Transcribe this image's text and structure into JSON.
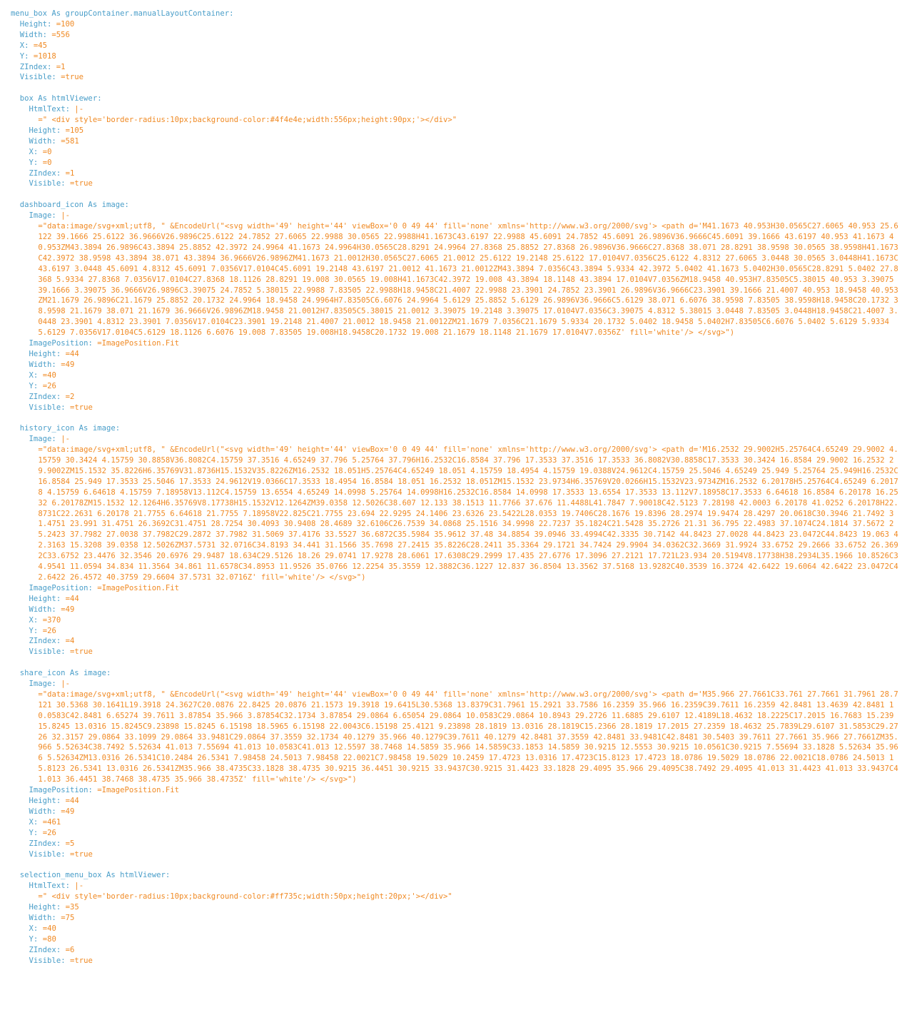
{
  "colors": {
    "key": "#4a9ec9",
    "value": "#f08a24",
    "background": "#ffffff"
  },
  "lines": [
    {
      "i": 0,
      "k": "menu_box As groupContainer.manualLayoutContainer:",
      "v": ""
    },
    {
      "i": 2,
      "k": "Height: ",
      "v": "=100"
    },
    {
      "i": 2,
      "k": "Width: ",
      "v": "=556"
    },
    {
      "i": 2,
      "k": "X: ",
      "v": "=45"
    },
    {
      "i": 2,
      "k": "Y: ",
      "v": "=1018"
    },
    {
      "i": 2,
      "k": "ZIndex: ",
      "v": "=1"
    },
    {
      "i": 2,
      "k": "Visible: ",
      "v": "=true"
    },
    {
      "i": 0,
      "k": "",
      "v": ""
    },
    {
      "i": 2,
      "k": "box As htmlViewer:",
      "v": ""
    },
    {
      "i": 4,
      "k": "HtmlText: ",
      "v": "|-"
    },
    {
      "i": 6,
      "k": "",
      "v": "=\" <div style='border-radius:10px;background-color:#4f4e4e;width:556px;height:90px;'></div>\""
    },
    {
      "i": 4,
      "k": "Height: ",
      "v": "=105"
    },
    {
      "i": 4,
      "k": "Width: ",
      "v": "=581"
    },
    {
      "i": 4,
      "k": "X: ",
      "v": "=0"
    },
    {
      "i": 4,
      "k": "Y: ",
      "v": "=0"
    },
    {
      "i": 4,
      "k": "ZIndex: ",
      "v": "=1"
    },
    {
      "i": 4,
      "k": "Visible: ",
      "v": "=true"
    },
    {
      "i": 0,
      "k": "",
      "v": ""
    },
    {
      "i": 2,
      "k": "dashboard_icon As image:",
      "v": ""
    },
    {
      "i": 4,
      "k": "Image: ",
      "v": "|-"
    },
    {
      "i": 6,
      "k": "",
      "v": "=\"data:image/svg+xml;utf8, \" &EncodeUrl(\"<svg width='49' height='44' viewBox='0 0 49 44' fill='none' xmlns='http://www.w3.org/2000/svg'> <path d='M41.1673 40.953H30.0565C27.6065 40.953 25.6122 39.1666 25.6122 36.9666V26.9896C25.6122 24.7852 27.6065 22.9988 30.0565 22.9988H41.1673C43.6197 22.9988 45.6091 24.7852 45.6091 26.9896V36.9666C45.6091 39.1666 43.6197 40.953 41.1673 40.953ZM43.3894 26.9896C43.3894 25.8852 42.3972 24.9964 41.1673 24.9964H30.0565C28.8291 24.9964 27.8368 25.8852 27.8368 26.9896V36.9666C27.8368 38.071 28.8291 38.9598 30.0565 38.9598H41.1673C42.3972 38.9598 43.3894 38.071 43.3894 36.9666V26.9896ZM41.1673 21.0012H30.0565C27.6065 21.0012 25.6122 19.2148 25.6122 17.0104V7.0356C25.6122 4.8312 27.6065 3.0448 30.0565 3.0448H41.1673C43.6197 3.0448 45.6091 4.8312 45.6091 7.0356V17.0104C45.6091 19.2148 43.6197 21.0012 41.1673 21.0012ZM43.3894 7.0356C43.3894 5.9334 42.3972 5.0402 41.1673 5.0402H30.0565C28.8291 5.0402 27.8368 5.9334 27.8368 7.0356V17.0104C27.8368 18.1126 28.8291 19.008 30.0565 19.008H41.1673C42.3972 19.008 43.3894 18.1148 43.3894 17.0104V7.0356ZM18.9458 40.953H7.83505C5.38015 40.953 3.39075 39.1666 3.39075 36.9666V26.9896C3.39075 24.7852 5.38015 22.9988 7.83505 22.9988H18.9458C21.4007 22.9988 23.3901 24.7852 23.3901 26.9896V36.9666C23.3901 39.1666 21.4007 40.953 18.9458 40.953ZM21.1679 26.9896C21.1679 25.8852 20.1732 24.9964 18.9458 24.9964H7.83505C6.6076 24.9964 5.6129 25.8852 5.6129 26.9896V36.9666C5.6129 38.071 6.6076 38.9598 7.83505 38.9598H18.9458C20.1732 38.9598 21.1679 38.071 21.1679 36.9666V26.9896ZM18.9458 21.0012H7.83505C5.38015 21.0012 3.39075 19.2148 3.39075 17.0104V7.0356C3.39075 4.8312 5.38015 3.0448 7.83505 3.0448H18.9458C21.4007 3.0448 23.3901 4.8312 23.3901 7.0356V17.0104C23.3901 19.2148 21.4007 21.0012 18.9458 21.0012ZM21.1679 7.0356C21.1679 5.9334 20.1732 5.0402 18.9458 5.0402H7.83505C6.6076 5.0402 5.6129 5.9334 5.6129 7.0356V17.0104C5.6129 18.1126 6.6076 19.008 7.83505 19.008H18.9458C20.1732 19.008 21.1679 18.1148 21.1679 17.0104V7.0356Z' fill='white'/> </svg>\")"
    },
    {
      "i": 4,
      "k": "ImagePosition: ",
      "v": "=ImagePosition.Fit"
    },
    {
      "i": 4,
      "k": "Height: ",
      "v": "=44"
    },
    {
      "i": 4,
      "k": "Width: ",
      "v": "=49"
    },
    {
      "i": 4,
      "k": "X: ",
      "v": "=40"
    },
    {
      "i": 4,
      "k": "Y: ",
      "v": "=26"
    },
    {
      "i": 4,
      "k": "ZIndex: ",
      "v": "=2"
    },
    {
      "i": 4,
      "k": "Visible: ",
      "v": "=true"
    },
    {
      "i": 0,
      "k": "",
      "v": ""
    },
    {
      "i": 2,
      "k": "history_icon As image:",
      "v": ""
    },
    {
      "i": 4,
      "k": "Image: ",
      "v": "|-"
    },
    {
      "i": 6,
      "k": "",
      "v": "=\"data:image/svg+xml;utf8, \" &EncodeUrl(\"<svg width='49' height='44' viewBox='0 0 49 44' fill='none' xmlns='http://www.w3.org/2000/svg'> <path d='M16.2532 29.9002H5.25764C4.65249 29.9002 4.15759 30.3424 4.15759 30.8858V36.8082C4.15759 37.3516 4.65249 37.796 5.25764 37.796H16.2532C16.8584 37.796 17.3533 37.3516 17.3533 36.8082V30.8858C17.3533 30.3424 16.8584 29.9002 16.2532 29.9002ZM15.1532 35.8226H6.35769V31.8736H15.1532V35.8226ZM16.2532 18.051H5.25764C4.65249 18.051 4.15759 18.4954 4.15759 19.0388V24.9612C4.15759 25.5046 4.65249 25.949 5.25764 25.949H16.2532C16.8584 25.949 17.3533 25.5046 17.3533 24.9612V19.0366C17.3533 18.4954 16.8584 18.051 16.2532 18.051ZM15.1532 23.9734H6.35769V20.0266H15.1532V23.9734ZM16.2532 6.20178H5.25764C4.65249 6.20178 4.15759 6.64618 4.15759 7.18958V13.112C4.15759 13.6554 4.65249 14.0998 5.25764 14.0998H16.2532C16.8584 14.0998 17.3533 13.6554 17.3533 13.112V7.18958C17.3533 6.64618 16.8584 6.20178 16.2532 6.20178ZM15.1532 12.1264H6.35769V8.17738H15.1532V12.1264ZM39.0358 12.5026C38.607 12.133 38.1513 11.7766 37.676 11.4488L41.7847 7.90018C42.5123 7.28198 42.0003 6.20178 41.0252 6.20178H22.8731C22.2631 6.20178 21.7755 6.64618 21.7755 7.18958V22.825C21.7755 23.694 22.9295 24.1406 23.6326 23.5422L28.0353 19.7406C28.1676 19.8396 28.2974 19.9474 28.4297 20.0618C30.3946 21.7492 31.4751 23.991 31.4751 26.3692C31.4751 28.7254 30.4093 30.9408 28.4689 32.6106C26.7539 34.0868 25.1516 34.9998 22.7237 35.1824C21.5428 35.2726 21.31 36.795 22.4983 37.1074C24.1814 37.5672 25.2423 37.7982 27.0038 37.7982C29.2872 37.7982 31.5069 37.4176 33.5527 36.6872C35.5984 35.9612 37.48 34.8854 39.0946 33.4994C42.3335 30.7142 44.8423 27.0028 44.8423 23.0472C44.8423 19.063 42.3163 15.3208 39.0358 12.5026ZM37.5731 32.0716C34.8193 34.441 31.1566 35.7698 27.2415 35.8226C28.2411 35.3364 29.1721 34.7424 29.9904 34.0362C32.3669 31.9924 33.6752 29.2666 33.6752 26.3692C33.6752 23.4476 32.3546 20.6976 29.9487 18.634C29.5126 18.26 29.0741 17.9278 28.6061 17.6308C29.2999 17.435 27.6776 17.3096 27.2121 17.721L23.934 20.5194V8.17738H38.2934L35.1966 10.8526C34.9541 11.0594 34.834 11.3564 34.861 11.6578C34.8953 11.9526 35.0766 12.2254 35.3559 12.3882C36.1227 12.837 36.8504 13.3562 37.5168 13.9282C40.3539 16.3724 42.6422 19.6064 42.6422 23.0472C42.6422 26.4572 40.3759 29.6604 37.5731 32.0716Z' fill='white'/> </svg>\")"
    },
    {
      "i": 4,
      "k": "ImagePosition: ",
      "v": "=ImagePosition.Fit"
    },
    {
      "i": 4,
      "k": "Height: ",
      "v": "=44"
    },
    {
      "i": 4,
      "k": "Width: ",
      "v": "=49"
    },
    {
      "i": 4,
      "k": "X: ",
      "v": "=370"
    },
    {
      "i": 4,
      "k": "Y: ",
      "v": "=26"
    },
    {
      "i": 4,
      "k": "ZIndex: ",
      "v": "=4"
    },
    {
      "i": 4,
      "k": "Visible: ",
      "v": "=true"
    },
    {
      "i": 0,
      "k": "",
      "v": ""
    },
    {
      "i": 2,
      "k": "share_icon As image:",
      "v": ""
    },
    {
      "i": 4,
      "k": "Image: ",
      "v": "|-"
    },
    {
      "i": 6,
      "k": "",
      "v": "=\"data:image/svg+xml;utf8, \" &EncodeUrl(\"<svg width='49' height='44' viewBox='0 0 49 44' fill='none' xmlns='http://www.w3.org/2000/svg'> <path d='M35.966 27.7661C33.761 27.7661 31.7961 28.7121 30.5368 30.1641L19.3918 24.3627C20.0876 22.8425 20.0876 21.1573 19.3918 19.6415L30.5368 13.8379C31.7961 15.2921 33.7586 16.2359 35.966 16.2359C39.7611 16.2359 42.8481 13.4639 42.8481 10.0583C42.8481 6.65274 39.7611 3.87854 35.966 3.87854C32.1734 3.87854 29.0864 6.65054 29.0864 10.0583C29.0864 10.8943 29.2726 11.6885 29.6107 12.4189L18.4632 18.2225C17.2015 16.7683 15.239 15.8245 13.0316 15.8245C9.23898 15.8245 6.15198 18.5965 6.15198 22.0043C6.15198 25.4121 9.23898 28.1819 13.0316 28.1819C15.2366 28.1819 17.2015 27.2359 18.4632 25.7839L29.6107 31.5853C29.2726 32.3157 29.0864 33.1099 29.0864 33.9481C29.0864 37.3559 32.1734 40.1279 35.966 40.1279C39.7611 40.1279 42.8481 37.3559 42.8481 33.9481C42.8481 30.5403 39.7611 27.7661 35.966 27.7661ZM35.966 5.52634C38.7492 5.52634 41.013 7.55694 41.013 10.0583C41.013 12.5597 38.7468 14.5859 35.966 14.5859C33.1853 14.5859 30.9215 12.5553 30.9215 10.0561C30.9215 7.55694 33.1828 5.52634 35.966 5.52634ZM13.0316 26.5341C10.2484 26.5341 7.98458 24.5013 7.98458 22.0021C7.98458 19.5029 10.2459 17.4723 13.0316 17.4723C15.8123 17.4723 18.0786 19.5029 18.0786 22.0021C18.0786 24.5013 15.8123 26.5341 13.0316 26.5341ZM35.966 38.4735C33.1828 38.4735 30.9215 36.4451 30.9215 33.9437C30.9215 31.4423 33.1828 29.4095 35.966 29.4095C38.7492 29.4095 41.013 31.4423 41.013 33.9437C41.013 36.4451 38.7468 38.4735 35.966 38.4735Z' fill='white'/> </svg>\")"
    },
    {
      "i": 4,
      "k": "ImagePosition: ",
      "v": "=ImagePosition.Fit"
    },
    {
      "i": 4,
      "k": "Height: ",
      "v": "=44"
    },
    {
      "i": 4,
      "k": "Width: ",
      "v": "=49"
    },
    {
      "i": 4,
      "k": "X: ",
      "v": "=461"
    },
    {
      "i": 4,
      "k": "Y: ",
      "v": "=26"
    },
    {
      "i": 4,
      "k": "ZIndex: ",
      "v": "=5"
    },
    {
      "i": 4,
      "k": "Visible: ",
      "v": "=true"
    },
    {
      "i": 0,
      "k": "",
      "v": ""
    },
    {
      "i": 2,
      "k": "selection_menu_box As htmlViewer:",
      "v": ""
    },
    {
      "i": 4,
      "k": "HtmlText: ",
      "v": "|-"
    },
    {
      "i": 6,
      "k": "",
      "v": "=\" <div style='border-radius:10px;background-color:#ff735c;width:50px;height:20px;'></div>\""
    },
    {
      "i": 4,
      "k": "Height: ",
      "v": "=35"
    },
    {
      "i": 4,
      "k": "Width: ",
      "v": "=75"
    },
    {
      "i": 4,
      "k": "X: ",
      "v": "=40"
    },
    {
      "i": 4,
      "k": "Y: ",
      "v": "=80"
    },
    {
      "i": 4,
      "k": "ZIndex: ",
      "v": "=6"
    },
    {
      "i": 4,
      "k": "Visible: ",
      "v": "=true"
    }
  ]
}
